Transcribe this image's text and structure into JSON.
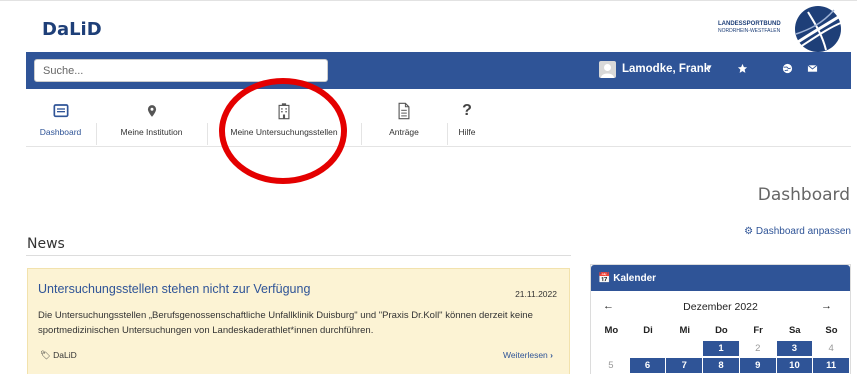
{
  "brand": "DaLiD",
  "partner_logo": {
    "line1": "LANDESSPORTBUND",
    "line2": "NORDRHEIN-WESTFALEN"
  },
  "search": {
    "placeholder": "Suche..."
  },
  "user": {
    "name": "Lamodke, Frank"
  },
  "subnav": [
    {
      "label": "Dashboard",
      "icon": "dashboard-icon",
      "active": true
    },
    {
      "label": "Meine Institution",
      "icon": "map-marker-icon"
    },
    {
      "label": "Meine Untersuchungsstellen",
      "icon": "building-icon"
    },
    {
      "label": "Anträge",
      "icon": "document-icon"
    },
    {
      "label": "Hilfe",
      "icon": "question-icon"
    }
  ],
  "page_title": "Dashboard",
  "dashboard_customize": "Dashboard anpassen",
  "news": {
    "heading": "News",
    "items": [
      {
        "title": "Untersuchungsstellen stehen nicht zur Verfügung",
        "date": "21.11.2022",
        "body": "Die Untersuchungsstellen „Berufsgenossenschaftliche Unfallklinik Duisburg\" und \"Praxis Dr.Koll\" können derzeit keine sportmedizinischen Untersuchungen von Landeskaderathlet*innen durchführen.",
        "tag": "DaLiD",
        "more": "Weiterlesen"
      }
    ]
  },
  "calendar": {
    "title": "Kalender",
    "month": "Dezember 2022",
    "prev": "←",
    "next": "→",
    "weekdays": [
      "Mo",
      "Di",
      "Mi",
      "Do",
      "Fr",
      "Sa",
      "So"
    ],
    "weeks": [
      [
        {
          "d": "",
          "active": false
        },
        {
          "d": "",
          "active": false
        },
        {
          "d": "",
          "active": false
        },
        {
          "d": "1",
          "active": true
        },
        {
          "d": "2",
          "active": false
        },
        {
          "d": "3",
          "active": true
        },
        {
          "d": "4",
          "active": false
        }
      ],
      [
        {
          "d": "5",
          "active": false
        },
        {
          "d": "6",
          "active": true
        },
        {
          "d": "7",
          "active": true
        },
        {
          "d": "8",
          "active": true
        },
        {
          "d": "9",
          "active": true
        },
        {
          "d": "10",
          "active": true
        },
        {
          "d": "11",
          "active": true
        }
      ]
    ]
  },
  "colors": {
    "primary": "#2f5497",
    "news_bg": "#fcf3d4",
    "annotation": "#e40000"
  }
}
